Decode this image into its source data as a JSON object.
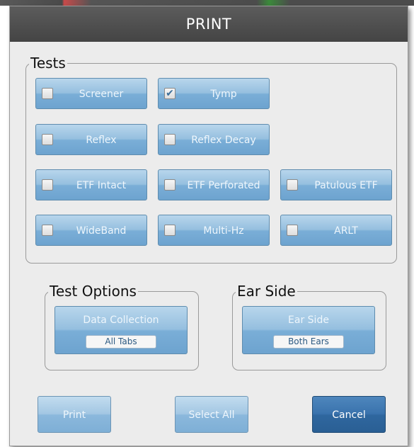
{
  "dialog": {
    "title": "PRINT"
  },
  "tests": {
    "legend": "Tests",
    "items": [
      {
        "label": "Screener",
        "checked": false
      },
      {
        "label": "Tymp",
        "checked": true
      },
      {
        "label": "Reflex",
        "checked": false
      },
      {
        "label": "Reflex Decay",
        "checked": false
      },
      {
        "label": "ETF Intact",
        "checked": false
      },
      {
        "label": "ETF Perforated",
        "checked": false
      },
      {
        "label": "Patulous ETF",
        "checked": false
      },
      {
        "label": "WideBand",
        "checked": false
      },
      {
        "label": "Multi-Hz",
        "checked": false
      },
      {
        "label": "ARLT",
        "checked": false
      }
    ]
  },
  "test_options": {
    "legend": "Test Options",
    "title": "Data Collection",
    "value": "All Tabs"
  },
  "ear_side": {
    "legend": "Ear Side",
    "title": "Ear Side",
    "value": "Both Ears"
  },
  "actions": {
    "print_label": "Print",
    "select_all_label": "Select All",
    "cancel_label": "Cancel"
  },
  "colors": {
    "button_blue": "#7aaed7",
    "cancel_blue": "#2f679f",
    "titlebar": "#4c4c4c",
    "checkmark": "#3d6f99"
  }
}
